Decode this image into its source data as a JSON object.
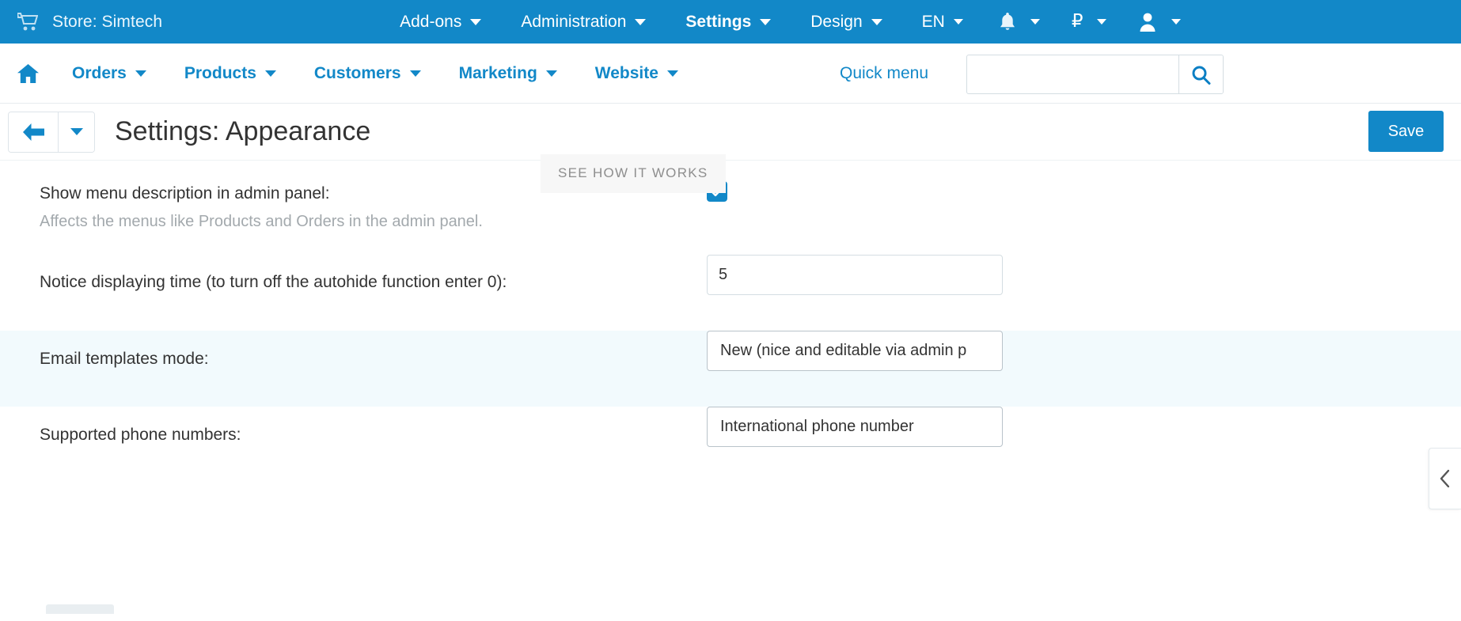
{
  "topbar": {
    "cart_icon": "shopping-cart-icon",
    "store_label": "Store: Simtech",
    "menus": [
      {
        "label": "Add-ons",
        "bold": false
      },
      {
        "label": "Administration",
        "bold": false
      },
      {
        "label": "Settings",
        "bold": true
      },
      {
        "label": "Design",
        "bold": false
      },
      {
        "label": "EN",
        "bold": false
      }
    ],
    "notifications_icon": "bell-icon",
    "currency_symbol": "₽",
    "account_icon": "user-icon"
  },
  "nav": {
    "home_icon": "home-icon",
    "items": [
      {
        "label": "Orders"
      },
      {
        "label": "Products"
      },
      {
        "label": "Customers"
      },
      {
        "label": "Marketing"
      },
      {
        "label": "Website"
      }
    ],
    "quick_menu_label": "Quick menu",
    "search": {
      "value": "",
      "placeholder": "",
      "icon": "search-icon"
    }
  },
  "titlebar": {
    "back_icon": "arrow-left-icon",
    "back_dropdown_icon": "chevron-down-icon",
    "title": "Settings: Appearance",
    "save_label": "Save"
  },
  "tooltip": {
    "text": "SEE HOW IT WORKS"
  },
  "form": {
    "rows": [
      {
        "label": "Show menu description in admin panel:",
        "description": "Affects the menus like Products and Orders in the admin panel.",
        "type": "checkbox",
        "checked": true
      },
      {
        "label": "Notice displaying time (to turn off the autohide function enter 0):",
        "type": "text",
        "value": "5"
      },
      {
        "label": "Email templates mode:",
        "type": "select",
        "value": "New (nice and editable via admin p"
      },
      {
        "label": "Supported phone numbers:",
        "type": "select",
        "value": "International phone number"
      }
    ]
  },
  "side_panel": {
    "toggle_icon": "chevron-left-icon"
  },
  "colors": {
    "brand_blue": "#1288c8",
    "link_blue": "#1288c8",
    "striped_row": "#f2fafd",
    "tooltip_bg": "#f7f7f7"
  }
}
